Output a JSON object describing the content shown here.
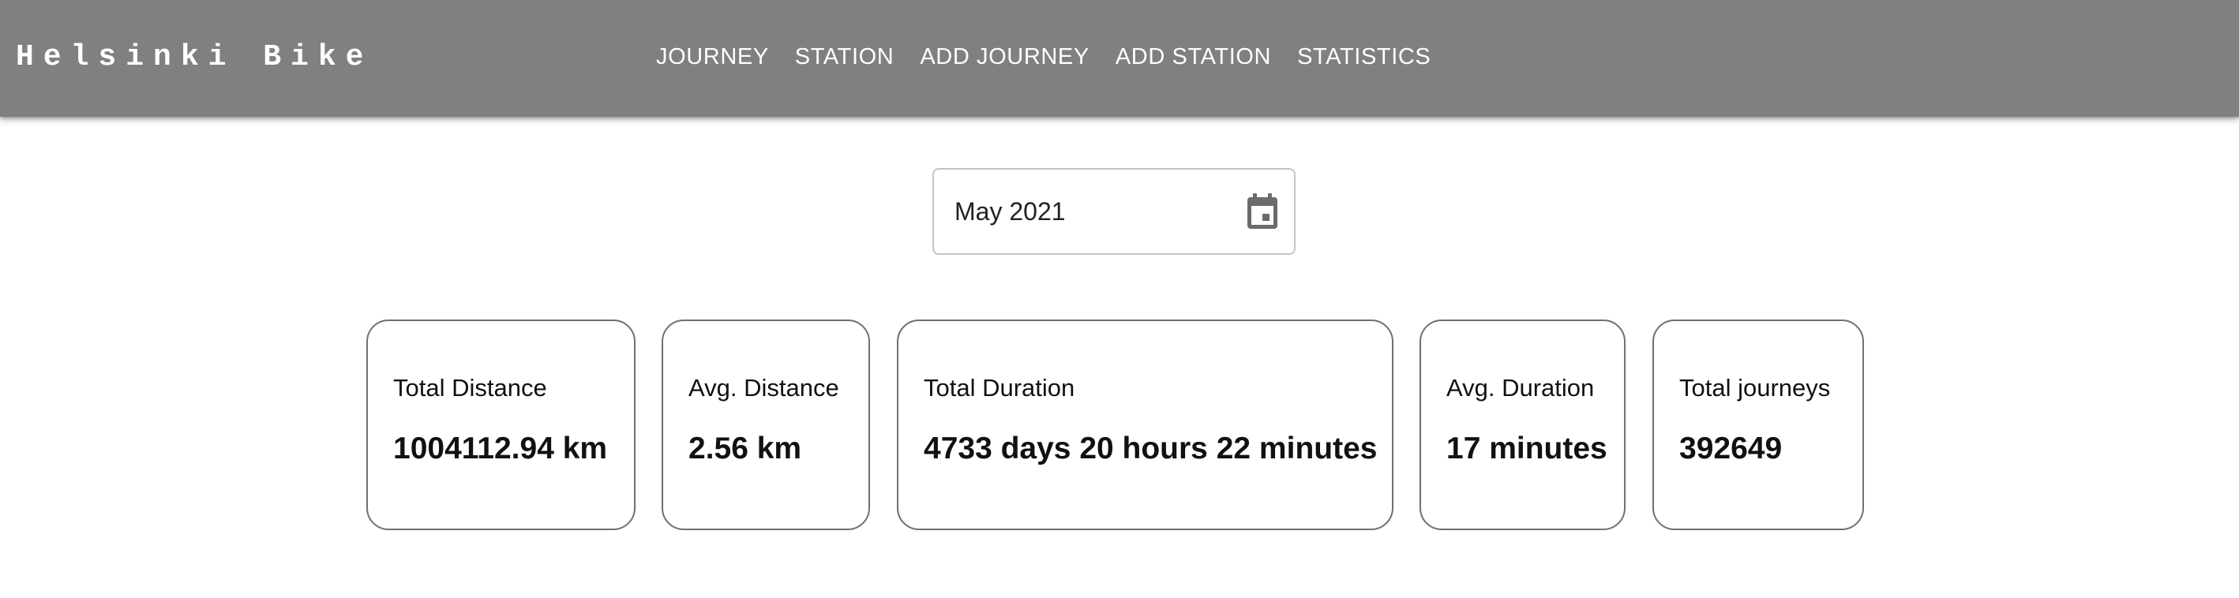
{
  "header": {
    "brand": "Helsinki Bike",
    "nav": [
      {
        "label": "JOURNEY"
      },
      {
        "label": "STATION"
      },
      {
        "label": "ADD JOURNEY"
      },
      {
        "label": "ADD STATION"
      },
      {
        "label": "STATISTICS"
      }
    ],
    "background_color": "#808080"
  },
  "date_picker": {
    "value": "May 2021",
    "icon": "calendar-icon"
  },
  "stats": [
    {
      "label": "Total Distance",
      "value": "1004112.94 km"
    },
    {
      "label": "Avg. Distance",
      "value": "2.56 km"
    },
    {
      "label": "Total Duration",
      "value": "4733 days 20 hours 22 minutes"
    },
    {
      "label": "Avg. Duration",
      "value": "17 minutes"
    },
    {
      "label": "Total journeys",
      "value": "392649"
    }
  ]
}
